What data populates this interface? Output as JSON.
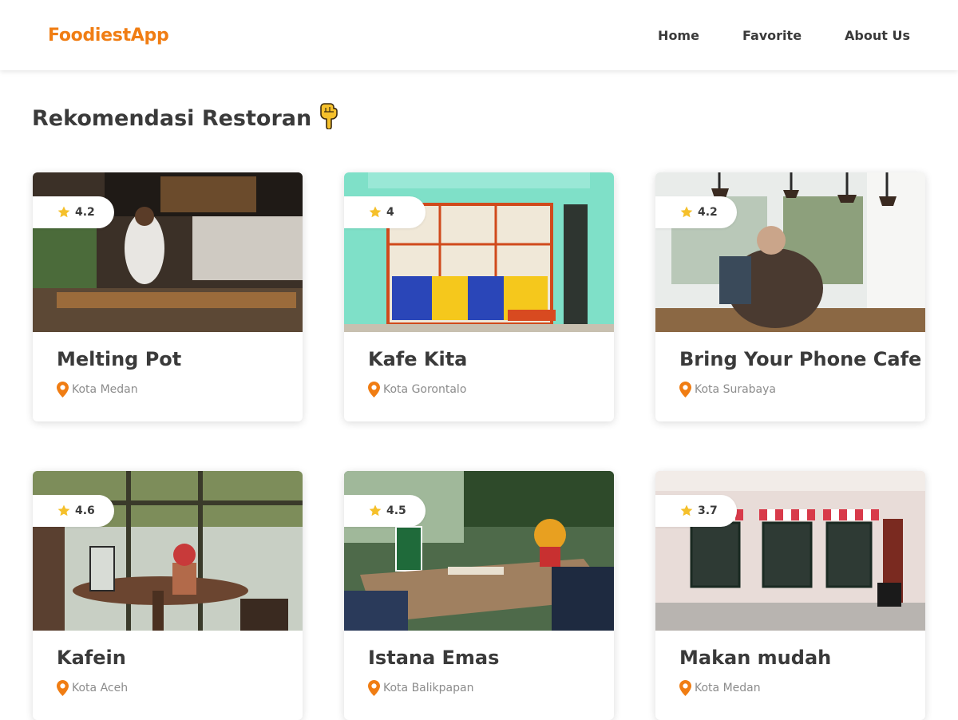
{
  "nav": {
    "brand": "FoodiestApp",
    "links": [
      "Home",
      "Favorite",
      "About Us"
    ]
  },
  "section": {
    "title": "Rekomendasi Restoran",
    "emoji": "hand-pointing-down-icon"
  },
  "colors": {
    "brand": "#f07d13",
    "star": "#f5c02b",
    "pin": "#f07d13",
    "text": "#3a3a3a",
    "muted": "#8c8c8c"
  },
  "restaurants": [
    {
      "name": "Melting Pot",
      "city": "Kota Medan",
      "rating": "4.2"
    },
    {
      "name": "Kafe Kita",
      "city": "Kota Gorontalo",
      "rating": "4"
    },
    {
      "name": "Bring Your Phone Cafe",
      "city": "Kota Surabaya",
      "rating": "4.2"
    },
    {
      "name": "Kafein",
      "city": "Kota Aceh",
      "rating": "4.6"
    },
    {
      "name": "Istana Emas",
      "city": "Kota Balikpapan",
      "rating": "4.5"
    },
    {
      "name": "Makan mudah",
      "city": "Kota Medan",
      "rating": "3.7"
    }
  ]
}
